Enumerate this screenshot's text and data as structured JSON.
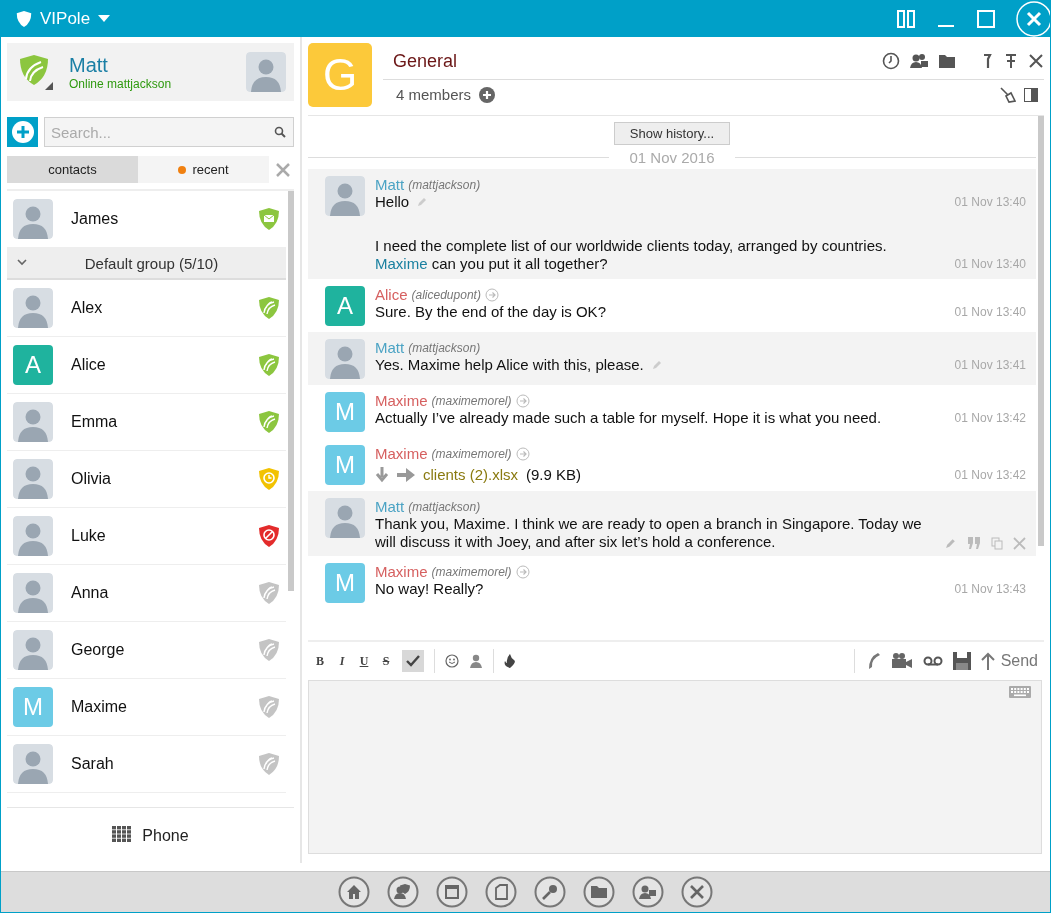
{
  "app": {
    "title": "VIPole"
  },
  "profile": {
    "name": "Matt",
    "status": "Online",
    "login": "mattjackson"
  },
  "search": {
    "placeholder": "Search..."
  },
  "tabs": [
    {
      "label": "contacts",
      "selected": true,
      "unread": false
    },
    {
      "label": "recent",
      "selected": false,
      "unread": true
    }
  ],
  "pinned": [
    {
      "name": "James",
      "kind": "message",
      "avatar": {
        "kind": "photo"
      }
    }
  ],
  "group": {
    "label": "Default group (5/10)",
    "expanded": true
  },
  "contacts": [
    {
      "name": "Alex",
      "kind": "online",
      "avatar": {
        "kind": "photo"
      }
    },
    {
      "name": "Alice",
      "kind": "online",
      "avatar": {
        "kind": "letter",
        "letter": "A",
        "color": "#1fb39e"
      }
    },
    {
      "name": "Emma",
      "kind": "online",
      "avatar": {
        "kind": "photo"
      }
    },
    {
      "name": "Olivia",
      "kind": "away",
      "avatar": {
        "kind": "photo"
      }
    },
    {
      "name": "Luke",
      "kind": "busy",
      "avatar": {
        "kind": "photo"
      }
    },
    {
      "name": "Anna",
      "kind": "offline",
      "avatar": {
        "kind": "photo"
      }
    },
    {
      "name": "George",
      "kind": "offline",
      "avatar": {
        "kind": "photo"
      }
    },
    {
      "name": "Maxime",
      "kind": "offline",
      "avatar": {
        "kind": "letter",
        "letter": "M",
        "color": "#6ccbe6"
      }
    },
    {
      "name": "Sarah",
      "kind": "offline",
      "avatar": {
        "kind": "photo"
      }
    }
  ],
  "phone_button": {
    "label": "Phone"
  },
  "chat": {
    "letter": "G",
    "title": "General",
    "members": "4 members"
  },
  "show_history": "Show history...",
  "date": "01 Nov 2016",
  "messages": [
    {
      "author": "Matt",
      "login": "(mattjackson)",
      "own": true,
      "shaded": true,
      "hovered": false,
      "avatar": {
        "kind": "photo"
      },
      "entries": [
        {
          "kind": "text",
          "text": "Hello",
          "edited": true,
          "time": "01 Nov 13:40"
        },
        {
          "kind": "mention",
          "text": "I need the complete list of our worldwide clients today, arranged by countries.",
          "mention": "Maxime",
          "text_after": "can you put it all together?",
          "time": "01 Nov 13:40"
        }
      ]
    },
    {
      "author": "Alice",
      "login": "(alicedupont)",
      "own": false,
      "shaded": false,
      "hovered": false,
      "avatar": {
        "kind": "letter",
        "letter": "A",
        "color": "#1fb39e"
      },
      "entries": [
        {
          "kind": "text",
          "text": "Sure. By the end of the day is OK?",
          "edited": false,
          "time": "01 Nov 13:40"
        }
      ]
    },
    {
      "author": "Matt",
      "login": "(mattjackson)",
      "own": true,
      "shaded": true,
      "hovered": false,
      "avatar": {
        "kind": "photo"
      },
      "entries": [
        {
          "kind": "text",
          "text": "Yes. Maxime help Alice with this, please.",
          "edited": true,
          "time": "01 Nov 13:41"
        }
      ]
    },
    {
      "author": "Maxime",
      "login": "(maximemorel)",
      "own": false,
      "shaded": false,
      "hovered": false,
      "avatar": {
        "kind": "letter",
        "letter": "M",
        "color": "#6ccbe6"
      },
      "entries": [
        {
          "kind": "text",
          "text": "Actually I’ve already made such a table for myself. Hope it is what you need.",
          "edited": false,
          "time": "01 Nov 13:42"
        }
      ]
    },
    {
      "author": "Maxime",
      "login": "(maximemorel)",
      "own": false,
      "shaded": false,
      "hovered": false,
      "avatar": {
        "kind": "letter",
        "letter": "M",
        "color": "#6ccbe6"
      },
      "entries": [
        {
          "kind": "file",
          "file_name": "clients (2).xlsx",
          "file_size": "(9.9 KB)",
          "time": "01 Nov 13:42"
        }
      ]
    },
    {
      "author": "Matt",
      "login": "(mattjackson)",
      "own": true,
      "shaded": true,
      "hovered": true,
      "avatar": {
        "kind": "photo"
      },
      "entries": [
        {
          "kind": "text",
          "text": "Thank you, Maxime. I think we are ready to open a branch in Singapore. Today we will discuss it with Joey, and after six let’s hold a conference.",
          "edited": false
        }
      ]
    },
    {
      "author": "Maxime",
      "login": "(maximemorel)",
      "own": false,
      "shaded": false,
      "hovered": false,
      "avatar": {
        "kind": "letter",
        "letter": "M",
        "color": "#6ccbe6"
      },
      "entries": [
        {
          "kind": "text",
          "text": "No way! Really?",
          "edited": false,
          "time": "01 Nov 13:43"
        }
      ]
    }
  ],
  "composer": {
    "format_buttons": [
      "B",
      "I",
      "U",
      "S"
    ],
    "spellcheck_on": true,
    "send_label": "Send"
  }
}
